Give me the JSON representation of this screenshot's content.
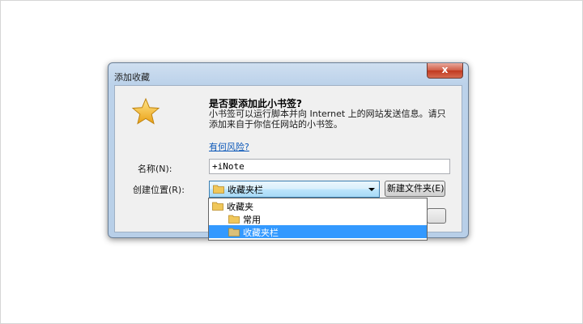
{
  "dialog": {
    "title": "添加收藏",
    "close_label": "x",
    "heading": "是否要添加此小书签?",
    "description_line1": "小书签可以运行脚本并向 Internet 上的网站发送信息。请只添加来自于你信任网站的小书签。",
    "risk_link": "有何风险?",
    "name_label": "名称(N):",
    "name_value": "+iNote",
    "location_label": "创建位置(R):",
    "location_selected": "收藏夹栏",
    "new_folder_button": "新建文件夹(E)"
  },
  "dropdown": {
    "items": [
      {
        "label": "收藏夹"
      },
      {
        "label": "常用"
      },
      {
        "label": "收藏夹栏"
      }
    ],
    "selected_index": 2
  },
  "colors": {
    "selection": "#3399ff",
    "star": "#f6c02a",
    "link": "#0b57b8",
    "folder": "#f0c75a"
  }
}
